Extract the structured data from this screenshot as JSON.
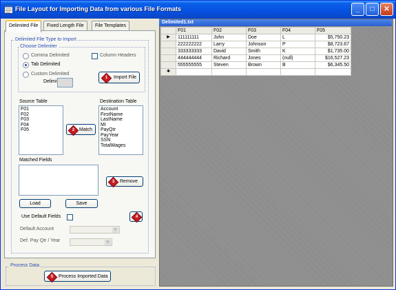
{
  "window": {
    "title": "File Layout for Importing Data from various File Formats",
    "controls": {
      "minimize": "_",
      "maximize": "□",
      "close": "✕"
    }
  },
  "tabs": [
    {
      "label": "Delimited File",
      "active": true
    },
    {
      "label": "Fixed Length File",
      "active": false
    },
    {
      "label": "File Templates",
      "active": false
    }
  ],
  "delimited": {
    "group_title": "Delimited File Type to Import",
    "delimiter_group": "Choose Delimiter",
    "options": [
      {
        "label": "Comma Delimited",
        "checked": false
      },
      {
        "label": "Tab Delimited",
        "checked": true
      },
      {
        "label": "Custom Delimited",
        "checked": false
      }
    ],
    "delimiter_label": "Delimiter",
    "delimiter_value": "",
    "column_headers_label": "Column Headers",
    "import_button": "Import File",
    "source_table_label": "Source Table",
    "source_fields": [
      "F01",
      "F02",
      "F03",
      "F04",
      "F05"
    ],
    "destination_table_label": "Destination Table",
    "destination_fields": [
      "Account",
      "FirstName",
      "LastName",
      "MI",
      "PayQtr",
      "PayYear",
      "SSN",
      "TotalWages"
    ],
    "match_button": "Match",
    "matched_fields_label": "Matched Fields",
    "remove_button": "Remove",
    "load_button": "Load",
    "save_button": "Save",
    "use_default_fields_label": "Use Default Fields",
    "default_account_label": "Default Account",
    "def_pay_label": "Def. Pay Qtr / Year"
  },
  "process": {
    "group_title": "Process Data",
    "button": "Process Imported Data"
  },
  "badges": [
    "1",
    "2",
    "3",
    "4",
    "5"
  ],
  "data_window": {
    "title": "Delimited1.txt",
    "columns": [
      "F01",
      "F02",
      "F03",
      "F04",
      "F05"
    ],
    "rows": [
      {
        "marker": "▶",
        "cells": [
          "111111111",
          "John",
          "Doe",
          "L",
          "$5,750.23"
        ]
      },
      {
        "marker": "",
        "cells": [
          "222222222",
          "Larry",
          "Johnson",
          "P",
          "$8,723.67"
        ]
      },
      {
        "marker": "",
        "cells": [
          "333333333",
          "David",
          "Smith",
          "K",
          "$1,735.00"
        ]
      },
      {
        "marker": "",
        "cells": [
          "444444444",
          "Richard",
          "Jones",
          "(null)",
          "$16,527.23"
        ]
      },
      {
        "marker": "",
        "cells": [
          "555555555",
          "Steven",
          "Brown",
          "B",
          "$6,345.50"
        ]
      }
    ],
    "new_row_marker": "✱"
  }
}
